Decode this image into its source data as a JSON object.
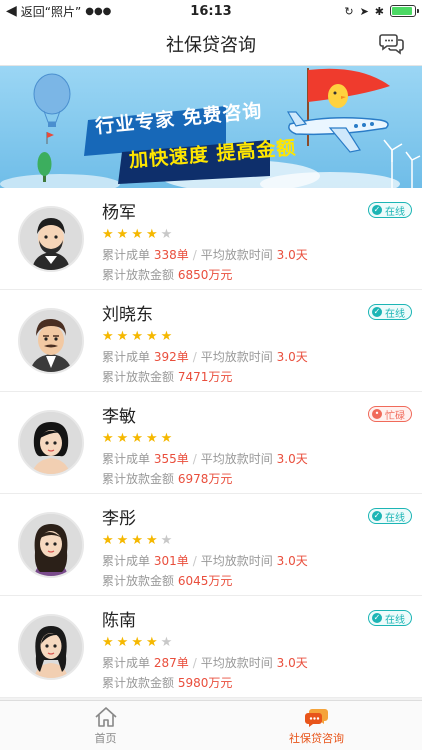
{
  "status_bar": {
    "back_text": "返回“照片”",
    "time": "16:13",
    "battery_level": 0.9
  },
  "nav": {
    "title": "社保贷咨询",
    "chat_icon": "chat-bubbles-icon"
  },
  "banner": {
    "line1": "行业专家 免费咨询",
    "line2": "加快速度 提高金额",
    "colors": {
      "sky": "#7fc8f0",
      "tag_blue": "#1768b8",
      "tag_dark": "#0e2f6b",
      "text_yellow": "#ffe600"
    }
  },
  "consultants": [
    {
      "name": "杨军",
      "rating": 4,
      "status": "在线",
      "status_type": "online",
      "orders_label": "累计成单",
      "orders": "338单",
      "avg_label": "平均放款时间",
      "avg": "3.0天",
      "amount_label": "累计放款金额",
      "amount": "6850万元",
      "avatar": "avatar-man-beard"
    },
    {
      "name": "刘晓东",
      "rating": 5,
      "status": "在线",
      "status_type": "online",
      "orders_label": "累计成单",
      "orders": "392单",
      "avg_label": "平均放款时间",
      "avg": "3.0天",
      "amount_label": "累计放款金额",
      "amount": "7471万元",
      "avatar": "avatar-man-mustache"
    },
    {
      "name": "李敏",
      "rating": 5,
      "status": "忙碌",
      "status_type": "busy",
      "orders_label": "累计成单",
      "orders": "355单",
      "avg_label": "平均放款时间",
      "avg": "3.0天",
      "amount_label": "累计放款金额",
      "amount": "6978万元",
      "avatar": "avatar-woman-short-hair"
    },
    {
      "name": "李彤",
      "rating": 4,
      "status": "在线",
      "status_type": "online",
      "orders_label": "累计成单",
      "orders": "301单",
      "avg_label": "平均放款时间",
      "avg": "3.0天",
      "amount_label": "累计放款金额",
      "amount": "6045万元",
      "avatar": "avatar-woman-long-hair"
    },
    {
      "name": "陈南",
      "rating": 4,
      "status": "在线",
      "status_type": "online",
      "orders_label": "累计成单",
      "orders": "287单",
      "avg_label": "平均放款时间",
      "avg": "3.0天",
      "amount_label": "累计放款金额",
      "amount": "5980万元",
      "avatar": "avatar-woman-side-part"
    }
  ],
  "tabs": [
    {
      "label": "首页",
      "icon": "home-icon",
      "active": false
    },
    {
      "label": "社保贷咨询",
      "icon": "chat-bubbles-icon",
      "active": true
    }
  ],
  "colors": {
    "accent": "#e8551a",
    "highlight": "#e94e3c",
    "online": "#1cb5b5",
    "busy": "#f06a5a",
    "star": "#f5b800"
  }
}
